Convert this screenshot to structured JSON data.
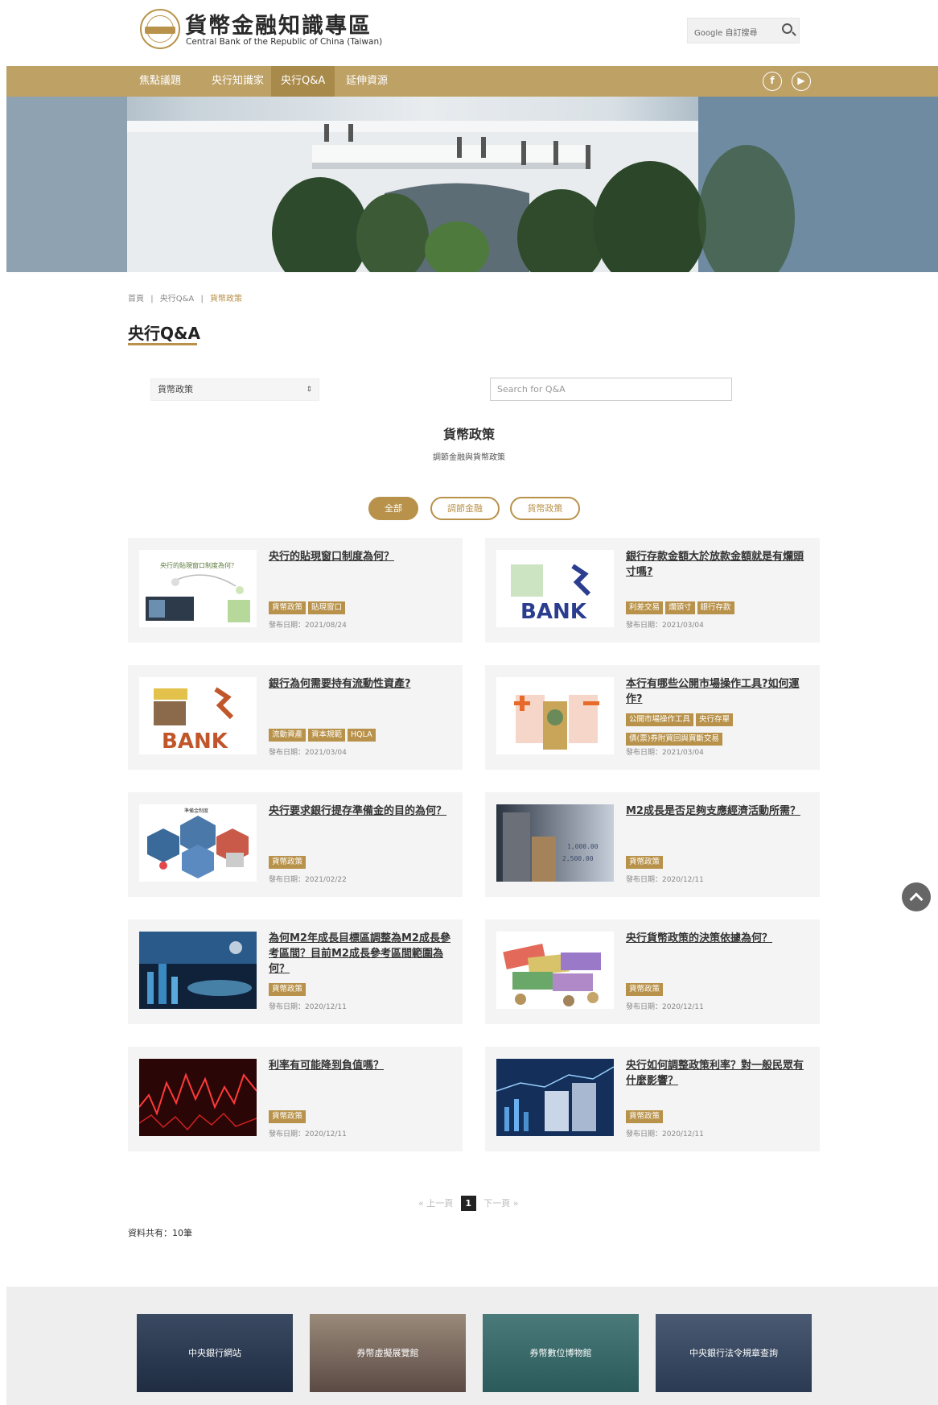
{
  "header": {
    "logo_seal_text": "中央銀行",
    "logo_title": "貨幣金融知識專區",
    "logo_subtitle": "Central Bank of the Republic of China (Taiwan)",
    "search_text": "Google 自訂搜尋"
  },
  "nav": {
    "items": [
      "焦點議題",
      "央行知識家",
      "央行Q&A",
      "延伸資源"
    ],
    "active": "央行Q&A",
    "social": [
      "facebook-icon",
      "youtube-icon"
    ]
  },
  "breadcrumb": {
    "home": "首頁",
    "sep": "|",
    "parent": "央行Q&A",
    "current": "貨幣政策"
  },
  "page_title": "央行Q&A",
  "filters": {
    "category_selected": "貨幣政策",
    "search_placeholder": "Search for Q&A"
  },
  "section": {
    "title": "貨幣政策",
    "subtitle": "調節金融與貨幣政策"
  },
  "pills": [
    "全部",
    "調節金融",
    "貨幣政策"
  ],
  "date_prefix": "發布日期：",
  "cards": [
    {
      "title": "央行的貼現窗口制度為何？",
      "tags": [
        "貨幣政策",
        "貼現窗口"
      ],
      "date": "2021/08/24",
      "thumb_caption": "央行的貼現窗口制度為何？"
    },
    {
      "title": "銀行存款金額大於放款金額就是有爛頭寸嗎?",
      "tags": [
        "利差交易",
        "爛頭寸",
        "銀行存款"
      ],
      "date": "2021/03/04",
      "thumb_caption": "BANK"
    },
    {
      "title": "銀行為何需要持有流動性資產?",
      "tags": [
        "流動資產",
        "資本規範",
        "HQLA"
      ],
      "date": "2021/03/04",
      "thumb_caption": "BANK"
    },
    {
      "title": "本行有哪些公開市場操作工具?如何運作?",
      "tags": [
        "公開市場操作工具",
        "央行存單",
        "債(票)券附買回與買斷交易"
      ],
      "date": "2021/03/04",
      "thumb_caption": ""
    },
    {
      "title": "央行要求銀行提存準備金的目的為何？",
      "tags": [
        "貨幣政策"
      ],
      "date": "2021/02/22",
      "thumb_caption": "準備金制度"
    },
    {
      "title": "M2成長是否足夠支應經濟活動所需？",
      "tags": [
        "貨幣政策"
      ],
      "date": "2020/12/11",
      "thumb_caption": ""
    },
    {
      "title": "為何M2年成長目標區調整為M2成長參考區間？目前M2成長參考區間範圍為何？",
      "tags": [
        "貨幣政策"
      ],
      "date": "2020/12/11",
      "thumb_caption": ""
    },
    {
      "title": "央行貨幣政策的決策依據為何？",
      "tags": [
        "貨幣政策"
      ],
      "date": "2020/12/11",
      "thumb_caption": ""
    },
    {
      "title": "利率有可能降到負值嗎？",
      "tags": [
        "貨幣政策"
      ],
      "date": "2020/12/11",
      "thumb_caption": ""
    },
    {
      "title": "央行如何調整政策利率？對一般民眾有什麼影響？",
      "tags": [
        "貨幣政策"
      ],
      "date": "2020/12/11",
      "thumb_caption": ""
    }
  ],
  "pager": {
    "prev": "« 上一頁",
    "current": "1",
    "next": "下一頁 »"
  },
  "total": "資料共有：10筆",
  "footer_links": [
    "中央銀行網站",
    "券幣虛擬展覽館",
    "券幣數位博物館",
    "中央銀行法令規章查詢"
  ],
  "colors": {
    "gold": "#b8924a",
    "nav": "#bea165",
    "card_bg": "#f4f4f4"
  }
}
